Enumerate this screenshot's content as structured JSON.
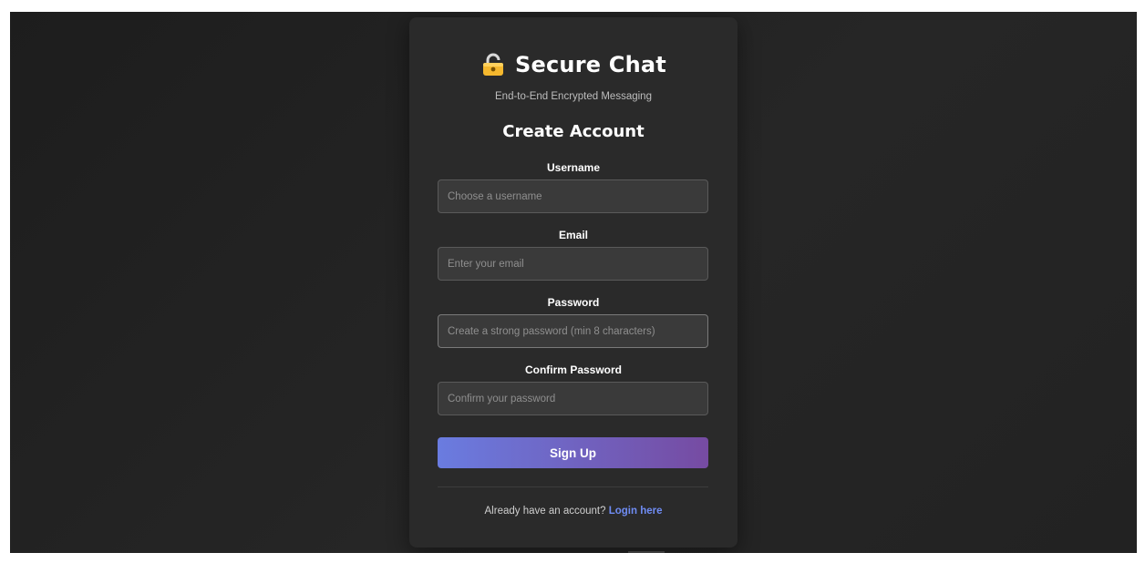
{
  "app": {
    "title": "Secure Chat",
    "icon": "lock-icon",
    "subtitle": "End-to-End Encrypted Messaging"
  },
  "form": {
    "title": "Create Account",
    "fields": [
      {
        "label": "Username",
        "placeholder": "Choose a username",
        "value": ""
      },
      {
        "label": "Email",
        "placeholder": "Enter your email",
        "value": ""
      },
      {
        "label": "Password",
        "placeholder": "Create a strong password (min 8 characters)",
        "value": ""
      },
      {
        "label": "Confirm Password",
        "placeholder": "Confirm your password",
        "value": ""
      }
    ],
    "submit_label": "Sign Up"
  },
  "footer": {
    "prompt": "Already have an account?",
    "link_label": "Login here"
  },
  "colors": {
    "background": "#222222",
    "card": "#2a2a2a",
    "button_gradient_start": "#6a7ce0",
    "button_gradient_end": "#764ba2",
    "link": "#6f8cf3",
    "lock_body": "#f5b82e"
  }
}
